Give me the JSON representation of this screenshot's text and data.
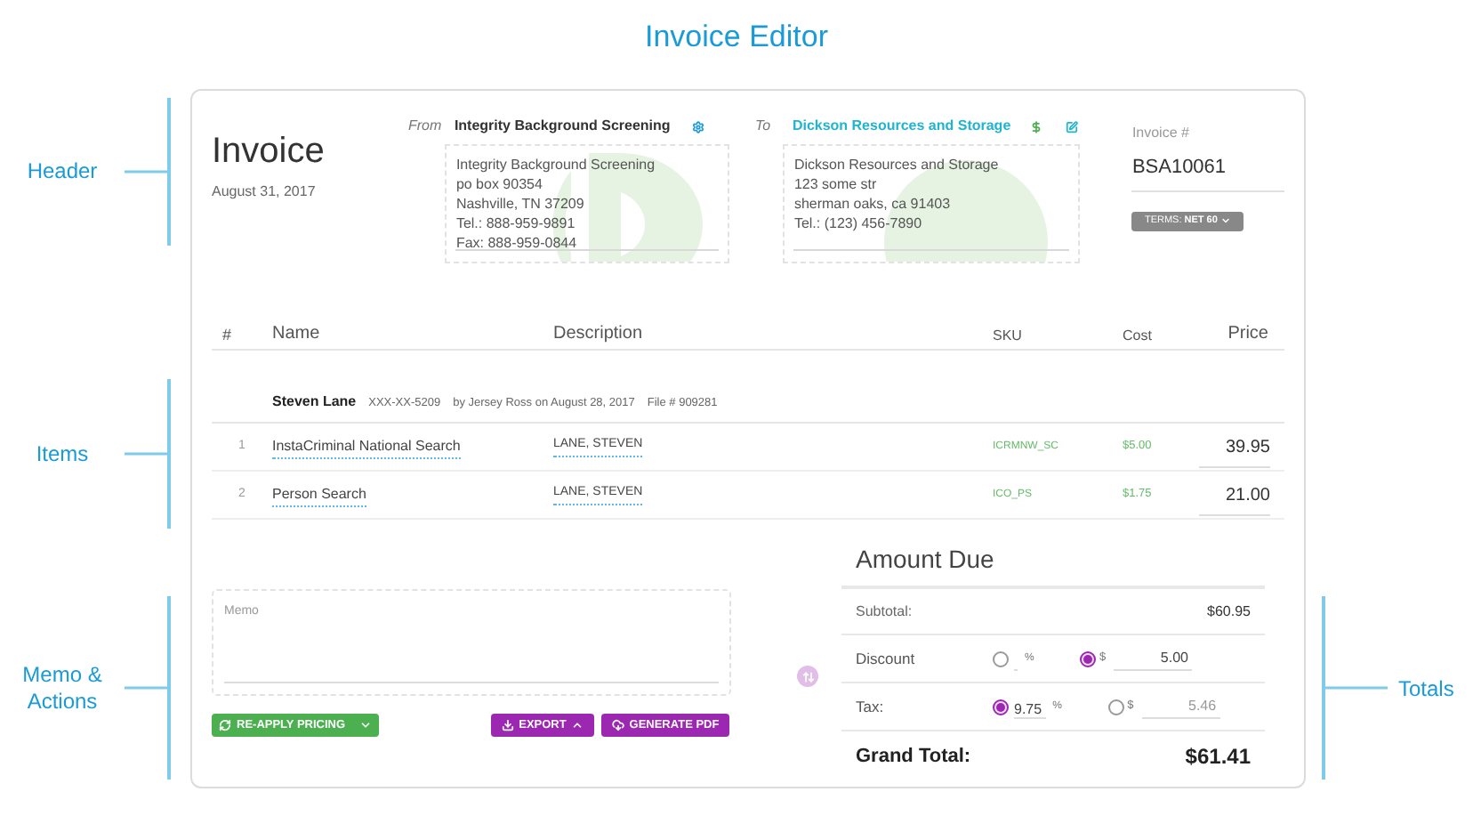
{
  "page_title": "Invoice Editor",
  "annotations": [
    {
      "label": "Header",
      "kind": "left"
    },
    {
      "label": "Items",
      "kind": "left"
    },
    {
      "label": "Memo & Actions",
      "kind": "left"
    },
    {
      "label": "Totals",
      "kind": "right"
    }
  ],
  "invoice": {
    "title": "Invoice",
    "date": "August 31, 2017"
  },
  "from": {
    "label": "From",
    "name": "Integrity Background Screening",
    "address": [
      "Integrity Background Screening",
      "po box 90354",
      "Nashville, TN 37209",
      "Tel.: 888-959-9891",
      "Fax: 888-959-0844"
    ]
  },
  "to": {
    "label": "To",
    "name": "Dickson Resources and Storage",
    "address": [
      "Dickson Resources and Storage",
      "123 some str",
      "sherman oaks, ca 91403",
      "Tel.: (123) 456-7890"
    ]
  },
  "invoice_number": {
    "label": "Invoice #",
    "value": "BSA10061"
  },
  "terms_button": {
    "label": "TERMS: **NET 60**"
  },
  "table": {
    "columns": [
      "#",
      "Name",
      "Description",
      "SKU",
      "Cost",
      "Price"
    ],
    "group": {
      "name": "Steven Lane",
      "ssn": "XXX-XX-5209",
      "ordered_by": "by Jersey Ross on August 28, 2017",
      "file": "File # 909281"
    },
    "rows": [
      {
        "number": "1",
        "name": "InstaCriminal National Search",
        "description": "LANE, STEVEN",
        "sku": "ICRMNW_SC",
        "cost": "$5.00",
        "price": "39.95"
      },
      {
        "number": "2",
        "name": "Person Search",
        "description": "LANE, STEVEN",
        "sku": "ICO_PS",
        "cost": "$1.75",
        "price": "21.00"
      }
    ]
  },
  "memo": {
    "placeholder": "Memo"
  },
  "actions": [
    {
      "label": "RE-APPLY PRICING",
      "kind": "split",
      "color": "#4caf50"
    },
    {
      "label": "EXPORT",
      "kind": "dropup",
      "color": "#9c27b0"
    },
    {
      "label": "GENERATE PDF",
      "kind": "plain",
      "color": "#9c27b0"
    }
  ],
  "totals": {
    "title": "Amount Due",
    "subtotal": {
      "label": "Subtotal:",
      "value": "$60.95"
    },
    "adjustments": [
      {
        "label": "Discount",
        "percent": {
          "selected": false,
          "unit": "%"
        },
        "amount": {
          "selected": true,
          "unit": "$",
          "value": "5.00"
        }
      },
      {
        "label": "Tax:",
        "percent": {
          "selected": true,
          "unit": "%",
          "value": "9.75"
        },
        "amount": {
          "selected": false,
          "unit": "$",
          "value": "5.46"
        }
      }
    ],
    "grand_total": {
      "label": "Grand Total:",
      "value": "$61.41"
    }
  }
}
